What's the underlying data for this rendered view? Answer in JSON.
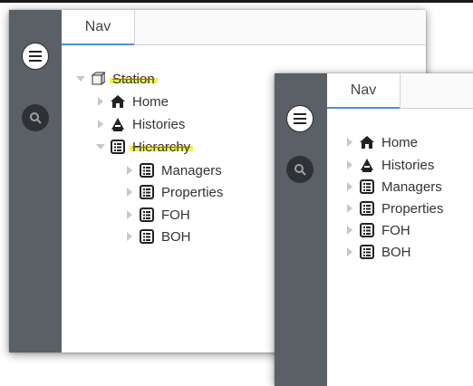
{
  "panel_front": {
    "tab_label": "Nav",
    "tree": [
      {
        "label": "Station",
        "icon": "station-icon",
        "expanded": true,
        "highlighted": true
      },
      {
        "label": "Home",
        "icon": "home-icon",
        "expanded": false
      },
      {
        "label": "Histories",
        "icon": "histories-icon",
        "expanded": false
      },
      {
        "label": "Hierarchy",
        "icon": "hierarchy-icon",
        "expanded": true,
        "highlighted": true
      },
      {
        "label": "Managers",
        "icon": "list-icon",
        "expanded": false
      },
      {
        "label": "Properties",
        "icon": "list-icon",
        "expanded": false
      },
      {
        "label": "FOH",
        "icon": "list-icon",
        "expanded": false
      },
      {
        "label": "BOH",
        "icon": "list-icon",
        "expanded": false
      }
    ]
  },
  "panel_back": {
    "tab_label": "Nav",
    "tree": [
      {
        "label": "Home",
        "icon": "home-icon"
      },
      {
        "label": "Histories",
        "icon": "histories-icon"
      },
      {
        "label": "Managers",
        "icon": "list-icon"
      },
      {
        "label": "Properties",
        "icon": "list-icon"
      },
      {
        "label": "FOH",
        "icon": "list-icon"
      },
      {
        "label": "BOH",
        "icon": "list-icon"
      }
    ]
  },
  "colors": {
    "rail": "#5b6066",
    "tab_underline": "#4a90d9",
    "highlight": "#e6ee28",
    "strike": "#ff3b30"
  }
}
